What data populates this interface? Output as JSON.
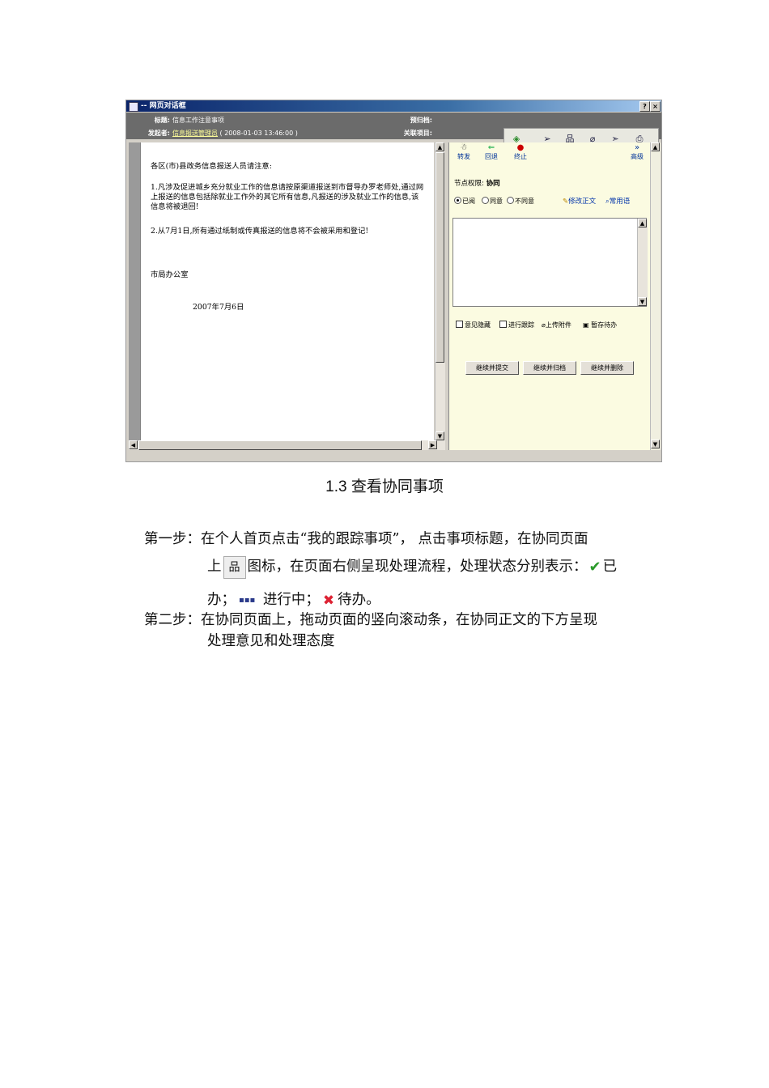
{
  "dialog": {
    "title": "-- 网页对话框",
    "title_buttons": [
      "?",
      "×"
    ],
    "subject_label": "标题:",
    "subject_value": "信息工作注意事项",
    "sender_label": "发起者:",
    "sender_name": "信息报送管理员",
    "sender_time": "( 2008-01-03 13:46:00 )",
    "archive_label": "预归档:",
    "related_label": "关联项目:",
    "toolbar_icons": [
      "process-icon",
      "forward-icon",
      "workflow-icon",
      "attachment-icon",
      "send-icon",
      "print-icon"
    ]
  },
  "document": {
    "greeting": "各区(市)县政务信息报送人员请注意:",
    "item1": "1.凡涉及促进城乡充分就业工作的信息请按原渠道报送到市督导办罗老师处,通过网上报送的信息包括除就业工作外的其它所有信息,凡报送的涉及就业工作的信息,该信息将被退回!",
    "item2": "2.从7月1日,所有通过纸制或传真报送的信息将不会被采用和登记!",
    "signature": "市局办公室",
    "date": "2007年7月6日"
  },
  "panel": {
    "forward": "转发",
    "back": "回退",
    "stop": "终止",
    "advanced": "高级",
    "permission_label": "节点权限:",
    "permission_value": "协同",
    "radio_read": "已阅",
    "radio_agree": "同意",
    "radio_disagree": "不同意",
    "edit_body": "修改正文",
    "common_phrases": "常用语",
    "hide_opinion": "意见隐藏",
    "track": "进行跟踪",
    "upload": "上传附件",
    "save_pending": "暂存待办",
    "btn_submit": "继续并提交",
    "btn_archive": "继续并归档",
    "btn_delete": "继续并删除"
  },
  "caption": "1.3 查看协同事项",
  "steps": {
    "step1_line1": "第一步：在个人首页点击“我的跟踪事项”，  点击事项标题，在协同页面",
    "step1_line2_a": "上",
    "step1_line2_b": "图标，在页面右侧呈现处理流程，处理状态分别表示：",
    "step1_line2_c": "已",
    "step1_line3_a": "办；",
    "step1_line3_b": " 进行中；",
    "step1_line3_c": "待办。",
    "step2_line1": "第二步：在协同页面上，拖动页面的竖向滚动条，在协同正文的下方呈现",
    "step2_line2": "处理意见和处理态度"
  }
}
